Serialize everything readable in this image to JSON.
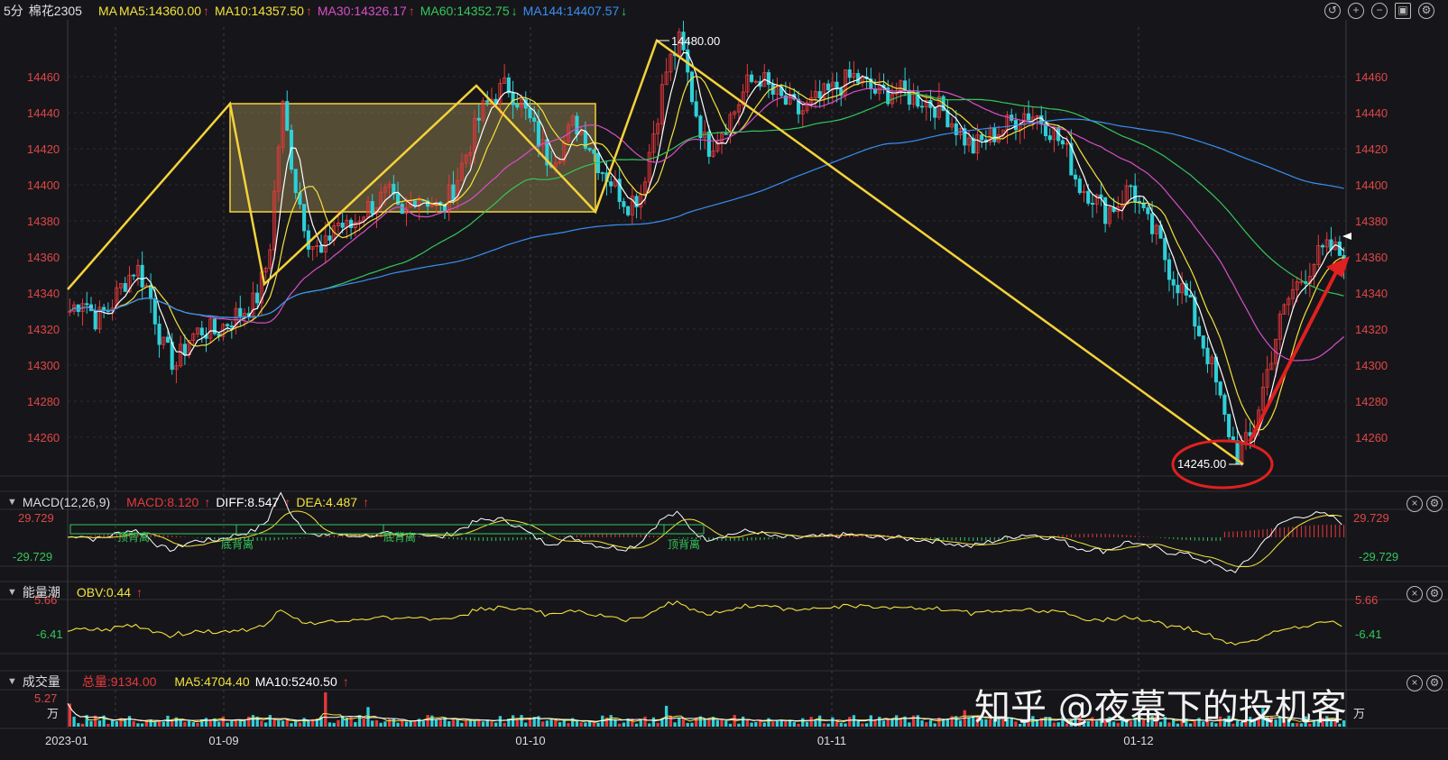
{
  "colors": {
    "up": "#e8383b",
    "down": "#2fd0d8",
    "ma5": "#ffffff",
    "ma10": "#f4e23c",
    "ma30": "#d94fc8",
    "ma60": "#34c759",
    "ma144": "#3a8ef2",
    "zigzag": "#f5d23a",
    "box": "#c9b36a",
    "annotation": "#e02020",
    "axis_label": "#e04646"
  },
  "main": {
    "period": "5分",
    "symbol": "棉花2305",
    "ma_prefix": "MA",
    "ma_items": [
      {
        "label": "MA5:14360.00",
        "arrow": "↑",
        "color": "#f4e23c",
        "arrow_color": "#e8383b"
      },
      {
        "label": "MA10:14357.50",
        "arrow": "↑",
        "color": "#f4e23c",
        "arrow_color": "#e8383b"
      },
      {
        "label": "MA30:14326.17",
        "arrow": "↑",
        "color": "#d94fc8",
        "arrow_color": "#e8383b"
      },
      {
        "label": "MA60:14352.75",
        "arrow": "↓",
        "color": "#34c759",
        "arrow_color": "#34c759"
      },
      {
        "label": "MA144:14407.57",
        "arrow": "↓",
        "color": "#3a8ef2",
        "arrow_color": "#34c759"
      }
    ],
    "toolbar_icons": [
      "undo-icon",
      "zoom-in-icon",
      "zoom-out-icon",
      "layout-icon",
      "settings-icon"
    ],
    "y_ticks": [
      "14460",
      "14440",
      "14420",
      "14400",
      "14380",
      "14360",
      "14340",
      "14320",
      "14300",
      "14280",
      "14260"
    ],
    "high_label": "14480.00",
    "low_label": "14245.00"
  },
  "macd": {
    "title": "MACD(12,26,9)",
    "macd": "MACD:8.120",
    "diff": "DIFF:8.547",
    "dea": "DEA:4.487",
    "arrow": "↑",
    "upper": "29.729",
    "lower": "-29.729",
    "notes": [
      "顶背离",
      "底背离",
      "底背离",
      "顶背离"
    ]
  },
  "obv": {
    "title": "能量潮",
    "obv": "OBV:0.44",
    "arrow": "↑",
    "upper": "5.66",
    "lower": "-6.41"
  },
  "volume": {
    "title": "成交量",
    "total": "总量:9134.00",
    "ma5": "MA5:4704.40",
    "ma10": "MA10:5240.50",
    "arrow": "↑",
    "upper": "5.27",
    "unit": "万"
  },
  "x_axis": {
    "labels": [
      "2023-01",
      "01-09",
      "01-10",
      "01-11",
      "01-12"
    ]
  },
  "watermark": "知乎 @夜幕下的投机客",
  "chart_data": {
    "type": "candlestick",
    "title": "",
    "y_range": [
      14240,
      14485
    ],
    "x_labels": [
      "2023-01",
      "01-09",
      "01-10",
      "01-11",
      "01-12"
    ],
    "key_points": [
      {
        "label": "high",
        "value": 14480
      },
      {
        "label": "low",
        "value": 14245
      }
    ],
    "zigzag_prices": [
      14342,
      14445,
      14345,
      14455,
      14385,
      14480,
      14245
    ],
    "consolidation_box": {
      "top": 14445,
      "bottom": 14385
    },
    "close_path": [
      14330,
      14338,
      14325,
      14332,
      14345,
      14355,
      14340,
      14310,
      14300,
      14315,
      14320,
      14318,
      14325,
      14330,
      14335,
      14360,
      14445,
      14400,
      14370,
      14360,
      14380,
      14375,
      14385,
      14390,
      14395,
      14380,
      14395,
      14392,
      14385,
      14400,
      14420,
      14440,
      14450,
      14455,
      14445,
      14430,
      14415,
      14420,
      14435,
      14425,
      14410,
      14400,
      14390,
      14395,
      14430,
      14465,
      14480,
      14445,
      14420,
      14430,
      14440,
      14455,
      14460,
      14450,
      14445,
      14440,
      14445,
      14450,
      14455,
      14460,
      14455,
      14450,
      14452,
      14450,
      14448,
      14445,
      14440,
      14430,
      14420,
      14425,
      14430,
      14435,
      14440,
      14438,
      14430,
      14420,
      14400,
      14395,
      14385,
      14390,
      14400,
      14380,
      14370,
      14350,
      14340,
      14320,
      14300,
      14270,
      14250,
      14260,
      14290,
      14320,
      14340,
      14350,
      14360,
      14365,
      14360
    ]
  }
}
